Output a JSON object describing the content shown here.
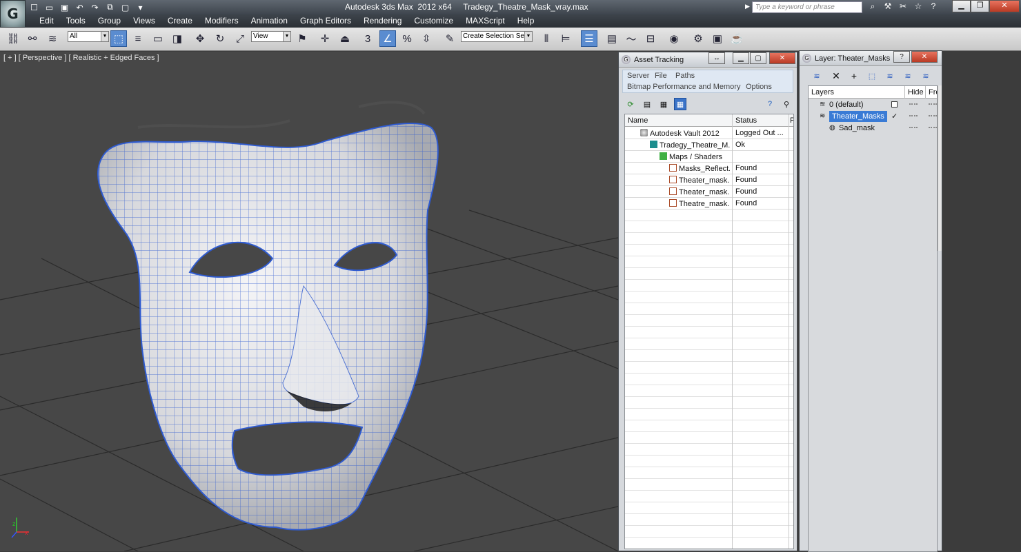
{
  "app": {
    "logo": "G",
    "title": "Autodesk 3ds Max  2012 x64     Tradegy_Theatre_Mask_vray.max",
    "search_placeholder": "Type a keyword or phrase"
  },
  "menu": [
    "Edit",
    "Tools",
    "Group",
    "Views",
    "Create",
    "Modifiers",
    "Animation",
    "Graph Editors",
    "Rendering",
    "Customize",
    "MAXScript",
    "Help"
  ],
  "toolbar": {
    "selection_filter": "All",
    "ref_coord": "View",
    "named_selection": "Create Selection Se"
  },
  "viewport": {
    "label": "[ + ] [ Perspective ] [ Realistic + Edged Faces ]",
    "axis_x": "x",
    "axis_z": "z"
  },
  "asset_tracking": {
    "title": "Asset Tracking",
    "menu_row1": [
      "Server",
      "File",
      "Paths"
    ],
    "menu_row2": [
      "Bitmap Performance and Memory",
      "Options"
    ],
    "columns": [
      "Name",
      "Status",
      "P"
    ],
    "rows": [
      {
        "name": "Autodesk Vault 2012",
        "status": "Logged Out ...",
        "icon": "vault-icon",
        "indent": 0
      },
      {
        "name": "Tradegy_Theatre_M...",
        "status": "Ok",
        "icon": "max-file-icon",
        "indent": 1
      },
      {
        "name": "Maps / Shaders",
        "status": "",
        "icon": "maps-icon",
        "indent": 2
      },
      {
        "name": "Masks_Reflect...",
        "status": "Found",
        "icon": "bitmap-icon",
        "indent": 3
      },
      {
        "name": "Theater_mask...",
        "status": "Found",
        "icon": "bitmap-icon",
        "indent": 3
      },
      {
        "name": "Theater_mask...",
        "status": "Found",
        "icon": "bitmap-icon",
        "indent": 3
      },
      {
        "name": "Theatre_mask...",
        "status": "Found",
        "icon": "bitmap-icon",
        "indent": 3
      }
    ]
  },
  "layer_panel": {
    "title": "Layer: Theater_Masks",
    "columns": [
      "Layers",
      "Hide",
      "Fre"
    ],
    "rows": [
      {
        "name": "0 (default)",
        "selected": false
      },
      {
        "name": "Theater_Masks",
        "selected": true
      },
      {
        "name": "Sad_mask",
        "selected": false
      }
    ]
  },
  "colors": {
    "viewport_bg": "#474747",
    "wire": "#2f5bd0",
    "selection": "#3a7bd5"
  }
}
